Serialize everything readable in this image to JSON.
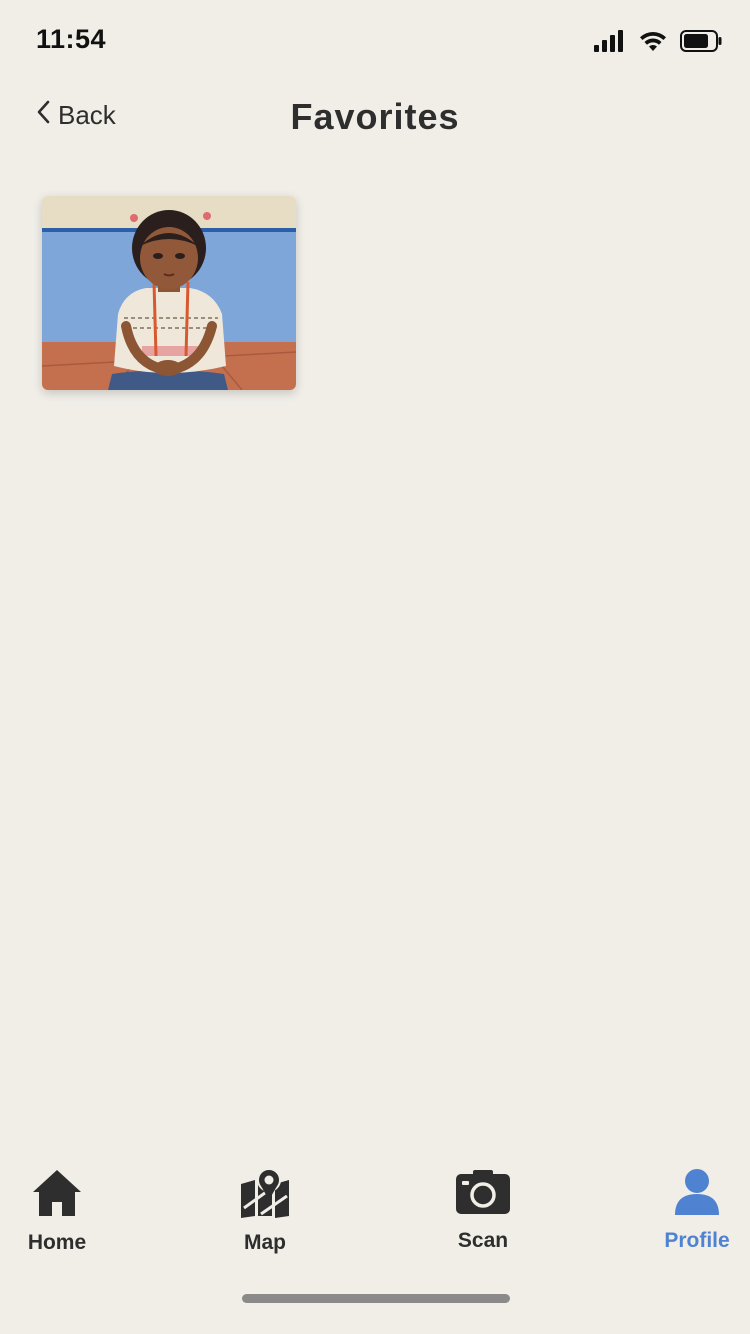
{
  "status_bar": {
    "time": "11:54"
  },
  "nav": {
    "back_label": "Back",
    "title": "Favorites"
  },
  "favorites": [
    {
      "thumbnail": "painting-portrait-of-child-icon"
    }
  ],
  "tabs": [
    {
      "label": "Home",
      "icon": "home-icon",
      "active": false
    },
    {
      "label": "Map",
      "icon": "map-pin-icon",
      "active": false
    },
    {
      "label": "Scan",
      "icon": "camera-icon",
      "active": false
    },
    {
      "label": "Profile",
      "icon": "person-icon",
      "active": true
    }
  ],
  "colors": {
    "background": "#f1eee8",
    "text": "#2e2e2e",
    "accent": "#4f82d0"
  }
}
